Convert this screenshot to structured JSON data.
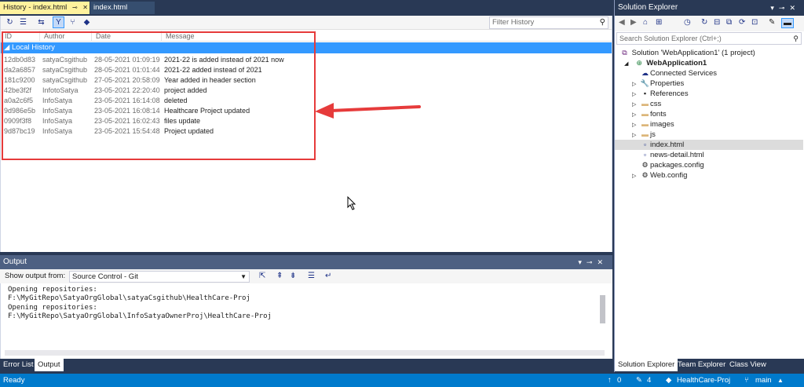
{
  "tabs": {
    "active": "History - index.html",
    "inactive": "index.html"
  },
  "history": {
    "filter_placeholder": "Filter History",
    "columns": [
      "ID",
      "Author",
      "Date",
      "Message"
    ],
    "group_label": "Local History",
    "rows": [
      {
        "id": "12db0d83",
        "author": "satyaCsgithub",
        "date": "28-05-2021 01:09:19",
        "message": "2021-22 is added instead of 2021 now"
      },
      {
        "id": "da2a6857",
        "author": "satyaCsgithub",
        "date": "28-05-2021 01:01:44",
        "message": "2021-22 added instead of 2021"
      },
      {
        "id": "181c9200",
        "author": "satyaCsgithub",
        "date": "27-05-2021 20:58:09",
        "message": "Year added in header section"
      },
      {
        "id": "42be3f2f",
        "author": "InfotoSatya",
        "date": "23-05-2021 22:20:40",
        "message": "project added"
      },
      {
        "id": "a0a2c6f5",
        "author": "InfoSatya",
        "date": "23-05-2021 16:14:08",
        "message": "deleted"
      },
      {
        "id": "9d986e5b",
        "author": "InfoSatya",
        "date": "23-05-2021 16:08:14",
        "message": "Healthcare Project updated"
      },
      {
        "id": "0909f3f8",
        "author": "InfoSatya",
        "date": "23-05-2021 16:02:43",
        "message": "files update"
      },
      {
        "id": "9d87bc19",
        "author": "InfoSatya",
        "date": "23-05-2021 15:54:48",
        "message": "Project updated"
      }
    ]
  },
  "output": {
    "title": "Output",
    "show_from_label": "Show output from:",
    "source": "Source Control - Git",
    "lines": [
      "Opening repositories:",
      "F:\\MyGitRepo\\SatyaOrgGlobal\\satyaCsgithub\\HealthCare-Proj",
      "Opening repositories:",
      "F:\\MyGitRepo\\SatyaOrgGlobal\\InfoSatyaOwnerProj\\HealthCare-Proj"
    ],
    "tabs": [
      "Error List",
      "Output"
    ]
  },
  "solution_explorer": {
    "title": "Solution Explorer",
    "search_placeholder": "Search Solution Explorer (Ctrl+;)",
    "solution": "Solution 'WebApplication1' (1 project)",
    "project": "WebApplication1",
    "items": [
      {
        "label": "Connected Services",
        "icon": "connected-services-icon",
        "expandable": false
      },
      {
        "label": "Properties",
        "icon": "wrench-icon",
        "expandable": true
      },
      {
        "label": "References",
        "icon": "references-icon",
        "expandable": true
      },
      {
        "label": "css",
        "icon": "folder-icon",
        "expandable": true
      },
      {
        "label": "fonts",
        "icon": "folder-icon",
        "expandable": true
      },
      {
        "label": "images",
        "icon": "folder-icon",
        "expandable": true
      },
      {
        "label": "js",
        "icon": "folder-icon",
        "expandable": true
      },
      {
        "label": "index.html",
        "icon": "html-file-icon",
        "expandable": false
      },
      {
        "label": "news-detail.html",
        "icon": "html-file-icon",
        "expandable": false
      },
      {
        "label": "packages.config",
        "icon": "config-file-icon",
        "expandable": false
      },
      {
        "label": "Web.config",
        "icon": "config-file-icon",
        "expandable": true
      }
    ],
    "bottom_tabs": [
      "Solution Explorer",
      "Team Explorer",
      "Class View"
    ]
  },
  "status": {
    "left": "Ready",
    "up_count": "0",
    "edit_count": "4",
    "repo": "HealthCare-Proj",
    "branch": "main"
  },
  "colors": {
    "accent": "#007acc",
    "selection": "#3399ff",
    "active_tab": "#fff29d",
    "highlight": "#e63b3b"
  }
}
